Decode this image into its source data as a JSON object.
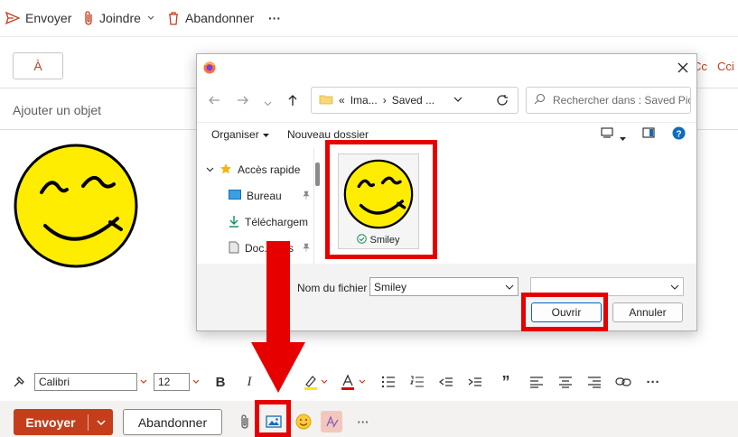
{
  "toolbar": {
    "send_label": "Envoyer",
    "attach_label": "Joindre",
    "discard_label": "Abandonner",
    "more": "···"
  },
  "compose": {
    "to_button": "À",
    "cc_label": "Cc",
    "bcc_label": "Cci",
    "subject_placeholder": "Ajouter un objet",
    "body_image_icon": "smiley-icon"
  },
  "format_bar": {
    "font_name": "Calibri",
    "font_size": "12",
    "bold": "B",
    "italic": "I",
    "quote": "”",
    "more": "···"
  },
  "bottom_bar": {
    "send_label": "Envoyer",
    "discard_label": "Abandonner",
    "more": "···"
  },
  "dialog": {
    "breadcrumb": {
      "prefix": "«",
      "part1": "Ima...",
      "separator": "›",
      "part2": "Saved ..."
    },
    "search_placeholder": "Rechercher dans : Saved Pict...",
    "commands": {
      "organize": "Organiser",
      "new_folder": "Nouveau dossier"
    },
    "nav_items": [
      {
        "label": "Accès rapide",
        "icon": "star-icon"
      },
      {
        "label": "Bureau",
        "icon": "desktop-icon"
      },
      {
        "label": "Téléchargem",
        "icon": "download-icon"
      },
      {
        "label": "Doc...ents",
        "icon": "documents-icon"
      }
    ],
    "file": {
      "name": "Smiley",
      "status_icon": "sync-check-icon"
    },
    "filename_label": "Nom du fichier :",
    "filename_value": "Smiley",
    "filter_value": "",
    "open_button": "Ouvrir",
    "cancel_button": "Annuler"
  },
  "colors": {
    "accent": "#c43e1c",
    "highlight": "#e60000",
    "smiley_fill": "#ffed00",
    "link_blue": "#0067c0"
  }
}
